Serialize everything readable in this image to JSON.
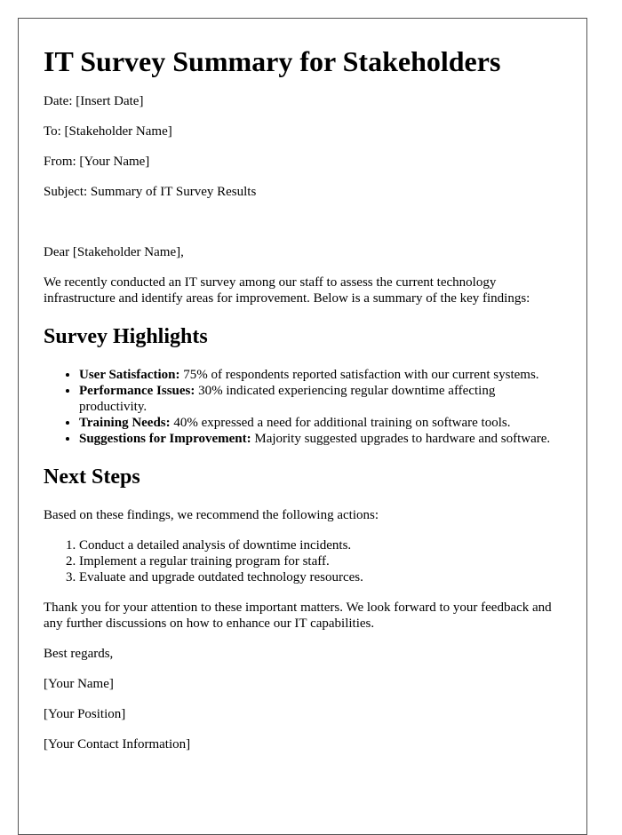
{
  "title": "IT Survey Summary for Stakeholders",
  "meta": {
    "date": "Date: [Insert Date]",
    "to": "To: [Stakeholder Name]",
    "from": "From: [Your Name]",
    "subject": "Subject: Summary of IT Survey Results"
  },
  "greeting": "Dear [Stakeholder Name],",
  "intro": "We recently conducted an IT survey among our staff to assess the current technology infrastructure and identify areas for improvement. Below is a summary of the key findings:",
  "highlights": {
    "heading": "Survey Highlights",
    "items": [
      {
        "label": "User Satisfaction:",
        "text": " 75% of respondents reported satisfaction with our current systems."
      },
      {
        "label": "Performance Issues:",
        "text": " 30% indicated experiencing regular downtime affecting productivity."
      },
      {
        "label": "Training Needs:",
        "text": " 40% expressed a need for additional training on software tools."
      },
      {
        "label": "Suggestions for Improvement:",
        "text": " Majority suggested upgrades to hardware and software."
      }
    ]
  },
  "next_steps": {
    "heading": "Next Steps",
    "intro": "Based on these findings, we recommend the following actions:",
    "items": [
      "Conduct a detailed analysis of downtime incidents.",
      "Implement a regular training program for staff.",
      "Evaluate and upgrade outdated technology resources."
    ]
  },
  "closing": "Thank you for your attention to these important matters. We look forward to your feedback and any further discussions on how to enhance our IT capabilities.",
  "signoff": "Best regards,",
  "signature": {
    "name": "[Your Name]",
    "position": "[Your Position]",
    "contact": "[Your Contact Information]"
  }
}
